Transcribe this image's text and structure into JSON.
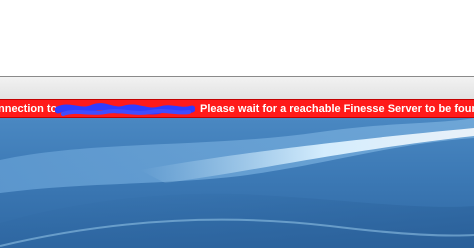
{
  "status": {
    "prefix": "nnection to",
    "message": "Please wait for a reachable Finesse Server to be found..."
  },
  "colors": {
    "banner": "#ff1a1a",
    "text": "#ffffff",
    "redaction": "#2f3cff",
    "desktop": "#3c79b5"
  }
}
